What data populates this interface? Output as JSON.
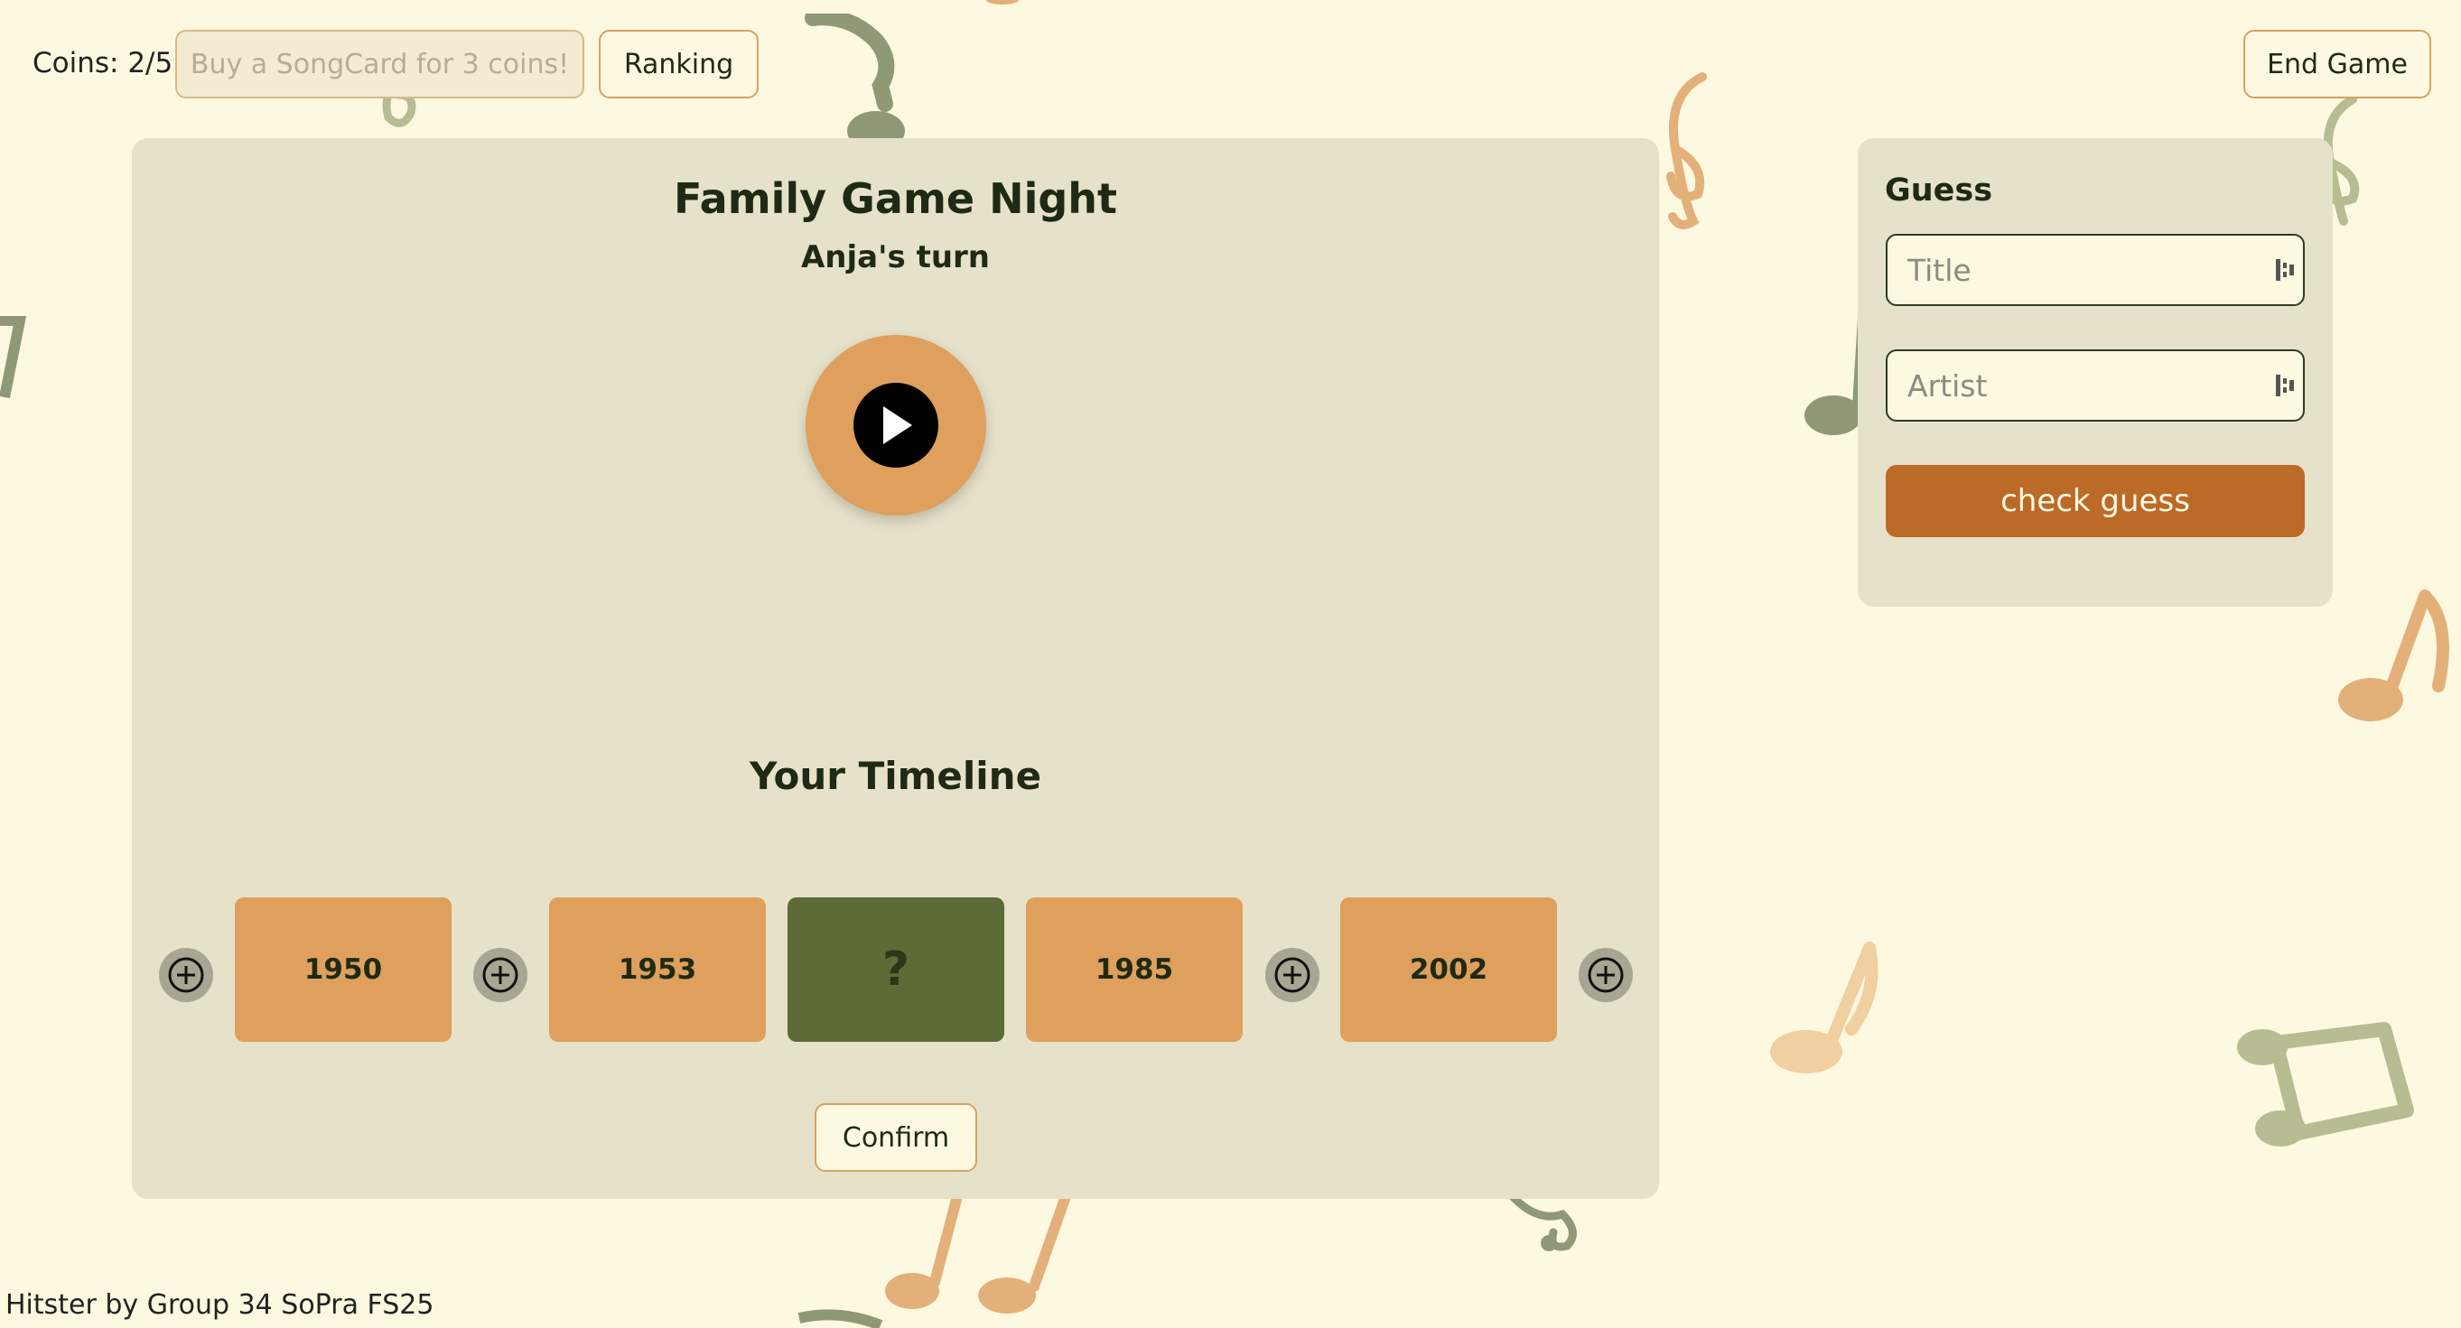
{
  "header": {
    "coins_text": "Coins: 2/5",
    "buy_label": "Buy a SongCard for 3 coins!",
    "ranking_label": "Ranking",
    "end_game_label": "End Game"
  },
  "game": {
    "title": "Family Game Night",
    "turn_text": "Anja's turn",
    "play_icon": "play-icon"
  },
  "timeline": {
    "title": "Your Timeline",
    "cards": [
      "1950",
      "1953",
      "?",
      "1985",
      "2002"
    ],
    "confirm_label": "Confirm"
  },
  "guess": {
    "title": "Guess",
    "title_placeholder": "Title",
    "artist_placeholder": "Artist",
    "check_label": "check guess"
  },
  "footer": {
    "text": "Hitster by Group 34 SoPra FS25"
  },
  "colors": {
    "background": "#fdf8e0",
    "panel": "#e6e1c9",
    "card": "#dea05c",
    "mystery_card": "#5d6b36",
    "accent_button": "#bc6a27",
    "text": "#1f2a14"
  }
}
